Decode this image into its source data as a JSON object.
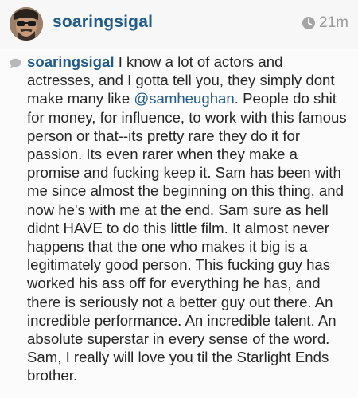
{
  "header": {
    "username": "soaringsigal",
    "time": "21m"
  },
  "caption": {
    "username": "soaringsigal",
    "text_before_mention": " I know a lot of actors and actresses, and I gotta tell you, they simply dont make many like ",
    "mention": "@samheughan",
    "text_after_mention": ". People do shit for money, for influence, to work with this famous person or that--its pretty rare they do it for passion. Its even rarer when they make a promise and fucking keep it. Sam has been with me since almost the beginning on this thing, and now he's with me at the end. Sam sure as hell didnt HAVE to do this little film. It almost never happens that the one who makes it big is a legitimately good person. This fucking guy has worked his ass off for everything he has, and there is seriously not a better guy out there. An incredible performance. An incredible talent. An absolute superstar in every sense of the word. Sam, I really will love you til the Starlight Ends brother."
  },
  "icons": {
    "clock": "clock-icon",
    "comment": "comment-bubble-icon"
  },
  "colors": {
    "username": "#215b8c",
    "time": "#9a9a9a",
    "header_bg": "#f7f7f7"
  }
}
